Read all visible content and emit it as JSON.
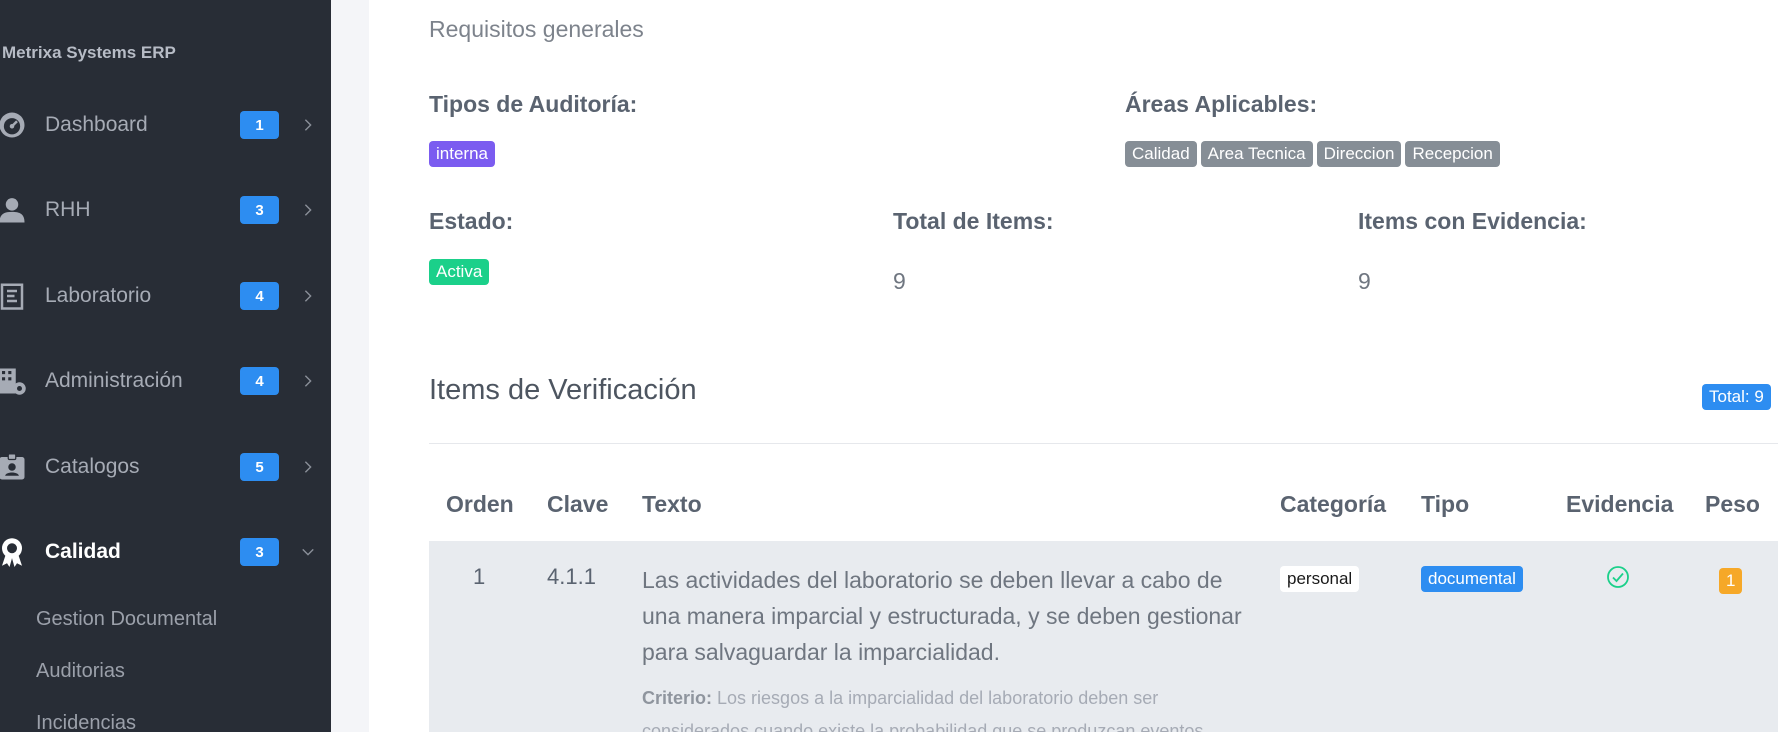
{
  "sidebar": {
    "brand": "Metrixa Systems ERP",
    "items": [
      {
        "label": "Dashboard",
        "badge": "1",
        "icon": "dashboard-gauge-icon"
      },
      {
        "label": "RHH",
        "badge": "3",
        "icon": "user-icon"
      },
      {
        "label": "Laboratorio",
        "badge": "4",
        "icon": "lab-icon"
      },
      {
        "label": "Administración",
        "badge": "4",
        "icon": "building-gear-icon"
      },
      {
        "label": "Catalogos",
        "badge": "5",
        "icon": "id-card-icon"
      },
      {
        "label": "Calidad",
        "badge": "3",
        "icon": "award-icon",
        "expanded": true
      }
    ],
    "subitems": [
      "Gestion Documental",
      "Auditorias",
      "Incidencias"
    ]
  },
  "details": {
    "subtitle": "Requisitos generales",
    "audit_types_label": "Tipos de Auditoría:",
    "audit_types": [
      "interna"
    ],
    "areas_label": "Áreas Aplicables:",
    "areas": [
      "Calidad",
      "Area Tecnica",
      "Direccion",
      "Recepcion"
    ],
    "status_label": "Estado:",
    "status": "Activa",
    "total_items_label": "Total de Items:",
    "total_items": "9",
    "items_evidence_label": "Items con Evidencia:",
    "items_evidence": "9"
  },
  "verification": {
    "title": "Items de Verificación",
    "total_badge": "Total: 9",
    "columns": [
      "Orden",
      "Clave",
      "Texto",
      "Categoría",
      "Tipo",
      "Evidencia",
      "Peso"
    ],
    "rows": [
      {
        "orden": "1",
        "clave": "4.1.1",
        "texto": "Las actividades del laboratorio se deben llevar a cabo de una manera imparcial y estructurada, y se deben gestionar para salvaguardar la imparcialidad.",
        "criterio_label": "Criterio:",
        "criterio": "Los riesgos a la imparcialidad del laboratorio deben ser considerados cuando existe la probabilidad que se produzcan eventos",
        "categoria": "personal",
        "tipo": "documental",
        "evidencia": "check-circle-icon",
        "peso": "1"
      }
    ]
  },
  "colors": {
    "sidebar_bg": "#282d36",
    "accent_blue": "#2d8df1",
    "purple": "#7b5cf0",
    "green": "#1bd08a",
    "orange": "#f6a828",
    "grey_badge": "#868e96"
  }
}
